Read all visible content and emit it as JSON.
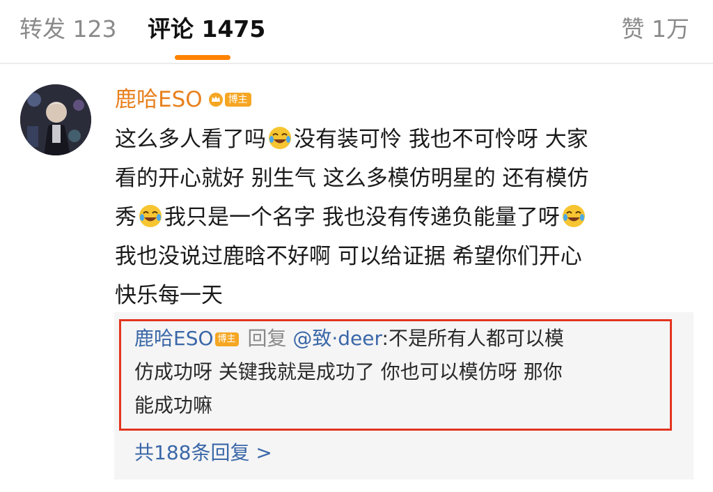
{
  "tabs": {
    "repost": "转发 123",
    "comments": "评论 1475",
    "likes": "赞 1万"
  },
  "accent_color": "#ff8200",
  "comment": {
    "username": "鹿哈ESO",
    "badge": "博主",
    "icons": [
      "crown-icon",
      "laughing-crying-emoji"
    ],
    "segments": {
      "l1a": "这么多人看了吗",
      "l1b": "没有装可怜 我也不可怜呀 大家",
      "l2": "看的开心就好 别生气 这么多模仿明星的 还有模仿",
      "l3a": "秀",
      "l3b": "我只是一个名字 我也没有传递负能量了呀",
      "l4": "我也没说过鹿晗不好啊 可以给证据 希望你们开心",
      "l5": "快乐每一天"
    }
  },
  "reply": {
    "username": "鹿哈ESO",
    "badge": "博主",
    "reply_word": "回复",
    "mention": "@致·deer",
    "text_l1": ":不是所有人都可以模",
    "text_l2": "仿成功呀 关键我就是成功了 你也可以模仿呀 那你",
    "text_l3": "能成功嘛",
    "highlight_color": "#e3341f"
  },
  "more_replies": "共188条回复 >"
}
